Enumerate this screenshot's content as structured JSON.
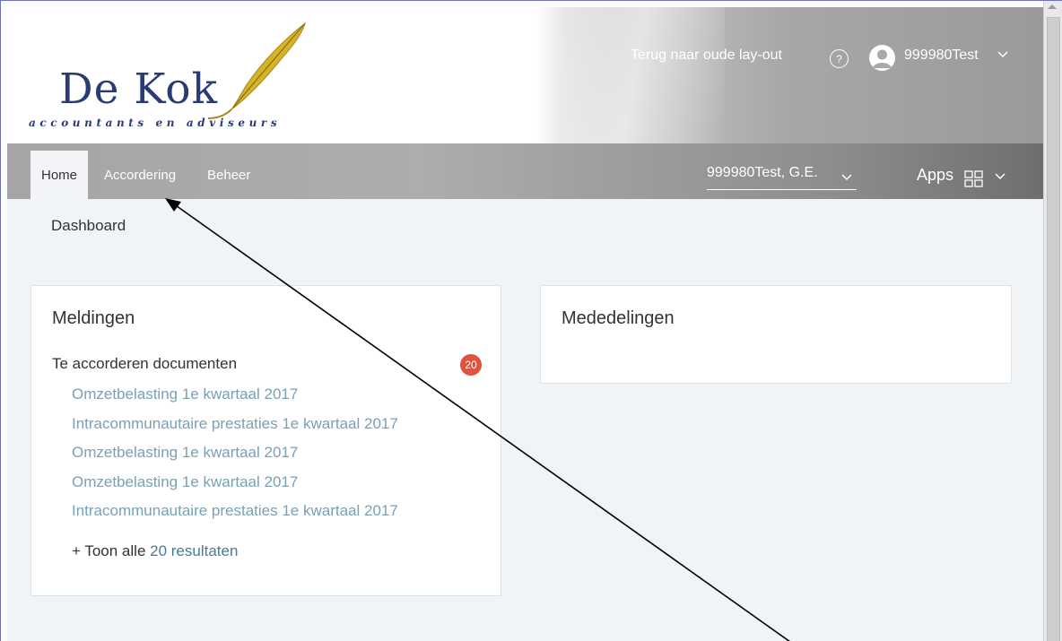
{
  "header": {
    "logo_name": "De Kok",
    "logo_subtitle": "accountants en adviseurs",
    "old_layout_link": "Terug naar oude lay-out",
    "help_symbol": "?",
    "user_name": "999980Test"
  },
  "nav": {
    "tabs": [
      {
        "label": "Home",
        "active": true
      },
      {
        "label": "Accordering",
        "active": false
      },
      {
        "label": "Beheer",
        "active": false
      }
    ],
    "client_select": "999980Test, G.E.",
    "apps_label": "Apps"
  },
  "breadcrumb": "Dashboard",
  "meldingen": {
    "title": "Meldingen",
    "section_title": "Te accorderen documenten",
    "badge_count": "20",
    "documents": [
      "Omzetbelasting 1e kwartaal 2017",
      "Intracommunautaire prestaties 1e kwartaal 2017",
      "Omzetbelasting 1e kwartaal 2017",
      "Omzetbelasting 1e kwartaal 2017",
      "Intracommunautaire prestaties 1e kwartaal 2017"
    ],
    "show_all_prefix": "+ Toon alle ",
    "show_all_link": "20 resultaten"
  },
  "mededelingen": {
    "title": "Mededelingen"
  },
  "colors": {
    "brand_navy": "#2a3b74",
    "link_blue": "#7aa0b6",
    "badge_red": "#e1533f",
    "content_bg": "#f1f4f7"
  },
  "icons": [
    "quill-icon",
    "help-icon",
    "user-avatar-icon",
    "chevron-down-icon",
    "apps-grid-icon",
    "scroll-up-icon"
  ]
}
